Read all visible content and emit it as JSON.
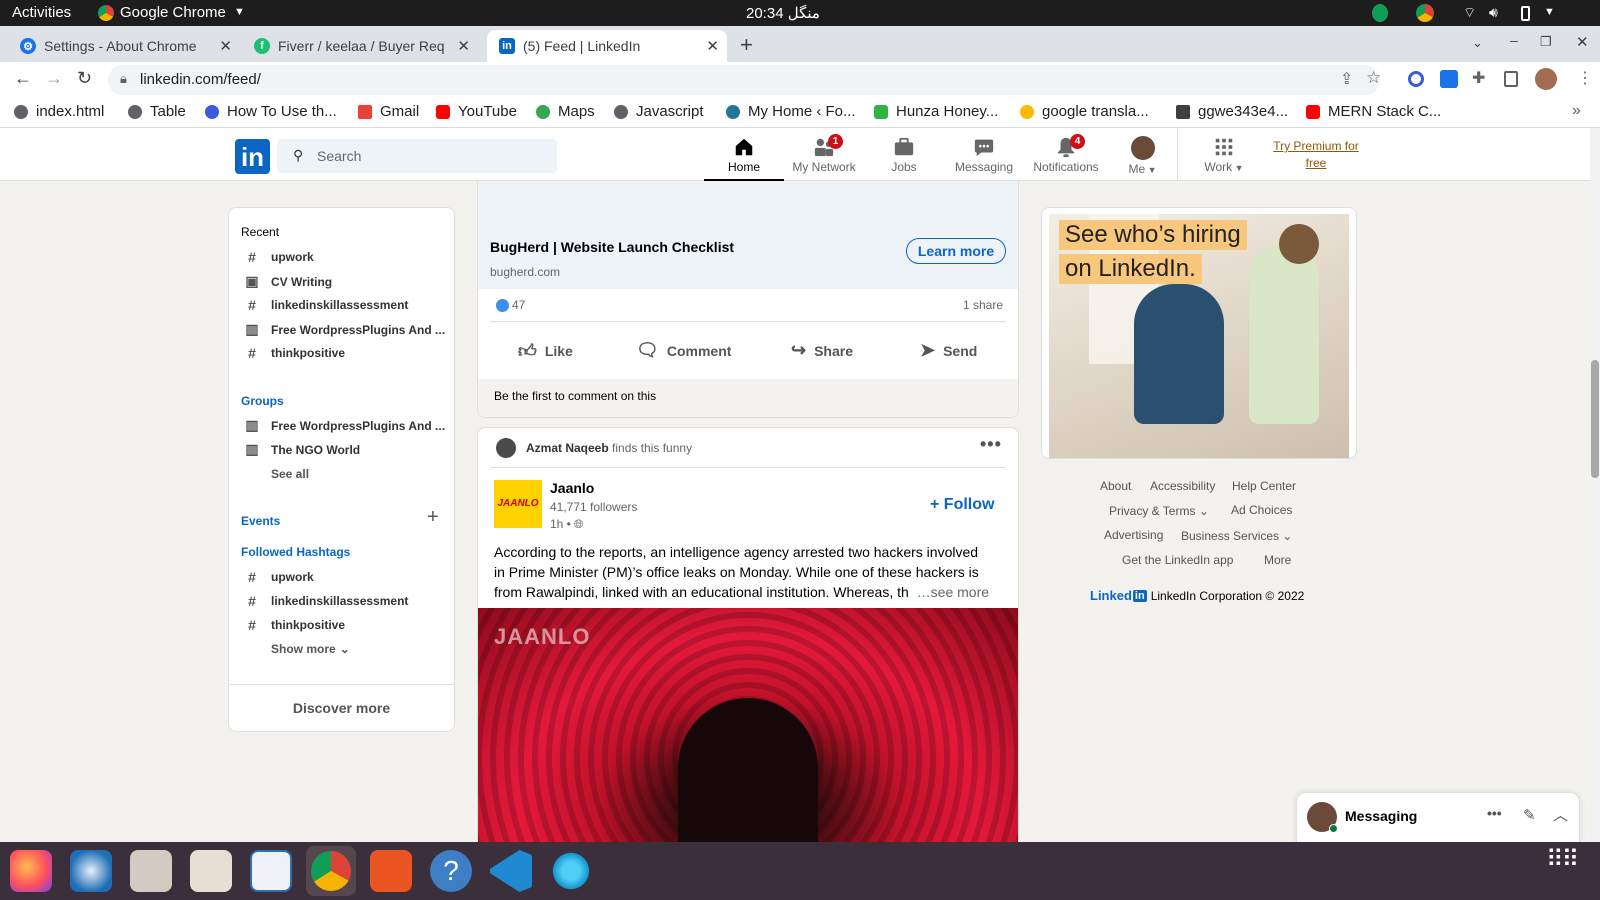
{
  "os_bar": {
    "activities": "Activities",
    "app": "Google Chrome",
    "clock": "20:34 منگل"
  },
  "tabs": [
    {
      "label": "Settings - About Chrome",
      "icon": "settings-gear-icon"
    },
    {
      "label": "Fiverr / keelaa / Buyer Req",
      "icon": "fiverr-icon"
    },
    {
      "label": "(5) Feed | LinkedIn",
      "icon": "linkedin-icon"
    }
  ],
  "address": {
    "url": "linkedin.com/feed/"
  },
  "bookmarks": [
    "index.html",
    "Table",
    "How To Use th...",
    "Gmail",
    "YouTube",
    "Maps",
    "Javascript",
    "My Home ‹ Fo...",
    "Hunza Honey...",
    "google transla...",
    "ggwe343e4...",
    "MERN Stack C..."
  ],
  "nav": {
    "search_placeholder": "Search",
    "items": [
      {
        "label": "Home",
        "icon": "home-icon"
      },
      {
        "label": "My Network",
        "icon": "network-icon",
        "badge": "1"
      },
      {
        "label": "Jobs",
        "icon": "briefcase-icon"
      },
      {
        "label": "Messaging",
        "icon": "chat-icon"
      },
      {
        "label": "Notifications",
        "icon": "bell-icon",
        "badge": "4"
      },
      {
        "label": "Me",
        "icon": "avatar-icon"
      },
      {
        "label": "Work",
        "icon": "grid-icon"
      }
    ],
    "premium_line1": "Try Premium for",
    "premium_line2": "free"
  },
  "left": {
    "recent_title": "Recent",
    "recent": [
      "upwork",
      "CV Writing",
      "linkedinskillassessment",
      "Free WordpressPlugins And ...",
      "thinkpositive"
    ],
    "groups_title": "Groups",
    "groups": [
      "Free WordpressPlugins And ...",
      "The NGO World"
    ],
    "see_all": "See all",
    "events_title": "Events",
    "hashtags_title": "Followed Hashtags",
    "hashtags": [
      "upwork",
      "linkedinskillassessment",
      "thinkpositive"
    ],
    "show_more": "Show more",
    "discover": "Discover more"
  },
  "post1": {
    "ad_title": "BugHerd | Website Launch Checklist",
    "ad_domain": "bugherd.com",
    "learn_more": "Learn more",
    "reactions": "47",
    "shares": "1 share",
    "actions": [
      "Like",
      "Comment",
      "Share",
      "Send"
    ],
    "first_comment": "Be the first to comment on this"
  },
  "post2": {
    "context_name": "Azmat Naqeeb",
    "context_text": "finds this funny",
    "author": "Jaanlo",
    "logo_text": "JAANLO",
    "followers": "41,771 followers",
    "time": "1h •",
    "follow": "+ Follow",
    "body_line1": "According to the reports, an intelligence agency arrested two hackers involved",
    "body_line2": "in Prime Minister (PM)’s office leaks on Monday. While one of these hackers is",
    "body_line3": "from Rawalpindi, linked with an educational institution. Whereas, th",
    "see_more": "…see more",
    "image_watermark": "JAANLO"
  },
  "ad": {
    "line1": "See who’s hiring",
    "line2": "on LinkedIn."
  },
  "footer": {
    "links": [
      "About",
      "Accessibility",
      "Help Center",
      "Privacy & Terms",
      "Ad Choices",
      "Advertising",
      "Business Services",
      "Get the LinkedIn app",
      "More"
    ],
    "brand": "Linked",
    "copyright": "LinkedIn Corporation © 2022"
  },
  "messaging": {
    "label": "Messaging"
  },
  "colors": {
    "linkedin_blue": "#0a66c2",
    "badge_red": "#cc1016",
    "ad_yellow": "#f8c77e"
  }
}
